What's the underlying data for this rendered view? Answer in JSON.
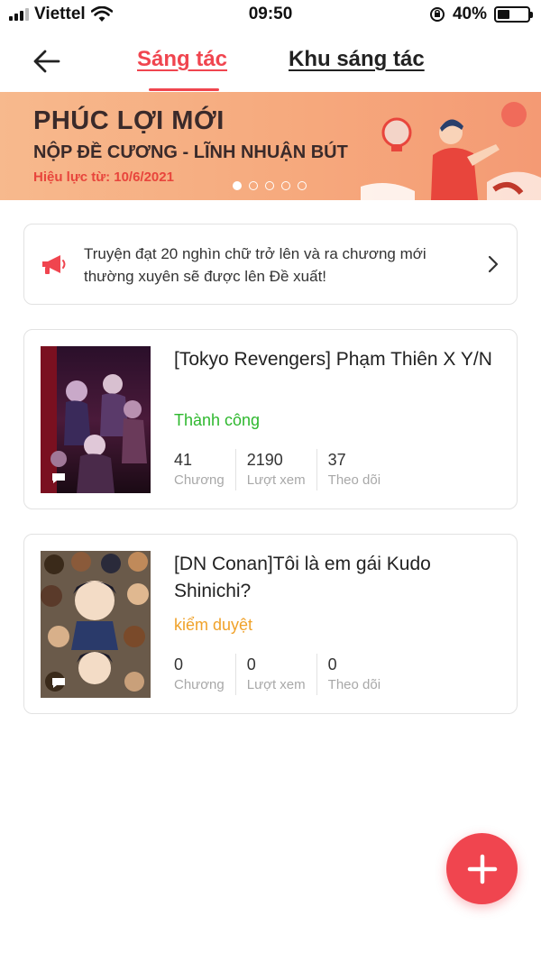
{
  "status_bar": {
    "carrier": "Viettel",
    "time": "09:50",
    "battery": "40%",
    "battery_level": 0.4
  },
  "header": {
    "tabs": [
      {
        "label": "Sáng tác",
        "active": true
      },
      {
        "label": "Khu sáng tác",
        "active": false
      }
    ]
  },
  "banner": {
    "title": "PHÚC LỢI MỚI",
    "subtitle": "NỘP ĐỀ CƯƠNG - LĨNH NHUẬN BÚT",
    "date": "Hiệu lực từ: 10/6/2021",
    "slide_count": 5,
    "active_slide": 1
  },
  "notice": {
    "text": "Truyện đạt 20 nghìn chữ trở lên và ra chương mới thường xuyên sẽ được lên Đề xuất!"
  },
  "stories": [
    {
      "title": "[Tokyo Revengers] Phạm Thiên X Y/N",
      "status": "Thành công",
      "status_color": "#2eb82e",
      "stats": [
        {
          "value": "41",
          "label": "Chương"
        },
        {
          "value": "2190",
          "label": "Lượt xem"
        },
        {
          "value": "37",
          "label": "Theo dõi"
        }
      ]
    },
    {
      "title": "[DN Conan]Tôi là em gái Kudo Shinichi?",
      "status": "kiểm duyệt",
      "status_color": "#f0a22a",
      "stats": [
        {
          "value": "0",
          "label": "Chương"
        },
        {
          "value": "0",
          "label": "Lượt xem"
        },
        {
          "value": "0",
          "label": "Theo dõi"
        }
      ]
    }
  ],
  "colors": {
    "accent": "#f0454f",
    "banner_bg": "#f6a97d"
  }
}
